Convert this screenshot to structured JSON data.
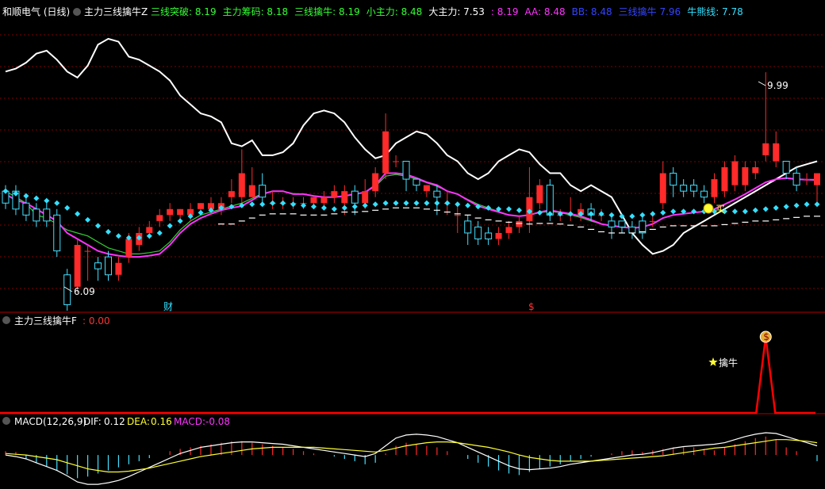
{
  "colors": {
    "up": "#ff2a2a",
    "down": "#44e0ff",
    "white": "#ffffff",
    "magenta": "#ff33ff",
    "green": "#33cc33",
    "cyan": "#33e0ff",
    "yellow": "#ffff33",
    "signal_line": "#ff0000",
    "grid": "#800000",
    "label_green": "#33ff33",
    "label_magenta": "#ff33ff",
    "label_blue": "#3344ff",
    "label_cyan": "#33e0ff",
    "label_red": "#ff3333"
  },
  "main_panel": {
    "stock": "和顺电气 (日线)",
    "indicator": "主力三线擒牛Z",
    "readouts": [
      {
        "label": "三线突破:",
        "value": "8.19",
        "color": "label_green"
      },
      {
        "label": "主力筹码:",
        "value": "8.18",
        "color": "label_green"
      },
      {
        "label": "三线擒牛:",
        "value": "8.19",
        "color": "label_green"
      },
      {
        "label": "小主力:",
        "value": "8.48",
        "color": "label_green"
      },
      {
        "label": "大主力:",
        "value": "7.53",
        "color": "white"
      },
      {
        "label": ":",
        "value": "8.19",
        "color": "label_magenta"
      },
      {
        "label": "AA:",
        "value": "8.48",
        "color": "label_magenta"
      },
      {
        "label": "BB:",
        "value": "8.48",
        "color": "label_blue"
      },
      {
        "label": "三线擒牛",
        "value": "7.96",
        "color": "label_blue"
      },
      {
        "label": "牛熊线:",
        "value": "7.78",
        "color": "label_cyan"
      }
    ],
    "price_high_label": "9.99",
    "price_low_label": "6.09",
    "event_label_cai": "财",
    "event_label_dollar": "$",
    "buy_label": "买"
  },
  "signal_panel": {
    "title": "主力三线擒牛F",
    "value": ": 0.00",
    "signal_label": "擒牛",
    "bag_icon": "$"
  },
  "macd_panel": {
    "title": "MACD(12,26,9)",
    "dif_label": "DIF:",
    "dif_value": "0.12",
    "dea_label": "DEA:",
    "dea_value": "0.16",
    "macd_label": "MACD:",
    "macd_value": "-0.08"
  },
  "chart_data": {
    "type": "candlestick",
    "price_range": [
      6.0,
      10.8
    ],
    "candles": [
      [
        8.0,
        7.8,
        8.1,
        7.7
      ],
      [
        8.0,
        7.7,
        8.1,
        7.6
      ],
      [
        7.8,
        7.6,
        7.9,
        7.5
      ],
      [
        7.7,
        7.5,
        7.8,
        7.4
      ],
      [
        7.7,
        7.5,
        7.8,
        7.4
      ],
      [
        7.6,
        7.0,
        7.7,
        6.9
      ],
      [
        6.6,
        6.1,
        6.7,
        6.0
      ],
      [
        6.4,
        7.1,
        7.2,
        6.3
      ],
      [
        7.0,
        7.0,
        7.1,
        6.5
      ],
      [
        6.8,
        6.7,
        6.9,
        6.5
      ],
      [
        6.9,
        6.6,
        7.0,
        6.5
      ],
      [
        6.6,
        6.8,
        6.9,
        6.5
      ],
      [
        6.9,
        7.2,
        7.3,
        6.8
      ],
      [
        7.1,
        7.3,
        7.4,
        7.0
      ],
      [
        7.3,
        7.4,
        7.5,
        7.2
      ],
      [
        7.5,
        7.6,
        7.7,
        7.4
      ],
      [
        7.6,
        7.7,
        7.8,
        7.5
      ],
      [
        7.6,
        7.7,
        7.7,
        7.5
      ],
      [
        7.6,
        7.7,
        7.8,
        7.5
      ],
      [
        7.7,
        7.8,
        7.8,
        7.6
      ],
      [
        7.7,
        7.8,
        7.9,
        7.6
      ],
      [
        7.7,
        7.8,
        7.9,
        7.6
      ],
      [
        7.9,
        8.0,
        8.2,
        7.8
      ],
      [
        7.9,
        8.3,
        8.7,
        7.8
      ],
      [
        7.9,
        8.1,
        8.4,
        7.9
      ],
      [
        8.1,
        7.9,
        8.3,
        7.8
      ],
      [
        7.8,
        7.8,
        8.0,
        7.7
      ],
      [
        7.8,
        7.8,
        7.9,
        7.7
      ],
      [
        7.8,
        7.8,
        7.9,
        7.7
      ],
      [
        7.8,
        7.8,
        7.9,
        7.7
      ],
      [
        7.8,
        7.9,
        7.9,
        7.7
      ],
      [
        7.8,
        7.9,
        8.0,
        7.7
      ],
      [
        7.9,
        8.0,
        8.1,
        7.8
      ],
      [
        7.8,
        8.0,
        8.1,
        7.6
      ],
      [
        8.0,
        7.8,
        8.1,
        7.6
      ],
      [
        7.8,
        8.0,
        8.2,
        7.7
      ],
      [
        8.0,
        8.3,
        8.4,
        7.9
      ],
      [
        8.3,
        9.0,
        9.3,
        8.2
      ],
      [
        8.5,
        8.5,
        8.6,
        8.4
      ],
      [
        8.5,
        8.2,
        8.5,
        8.0
      ],
      [
        8.2,
        8.1,
        8.2,
        8.0
      ],
      [
        8.0,
        8.1,
        8.1,
        7.9
      ],
      [
        8.0,
        7.9,
        8.1,
        7.6
      ],
      [
        7.8,
        7.8,
        8.0,
        7.6
      ],
      [
        7.6,
        7.6,
        7.8,
        7.3
      ],
      [
        7.5,
        7.3,
        7.6,
        7.1
      ],
      [
        7.4,
        7.2,
        7.5,
        7.1
      ],
      [
        7.3,
        7.2,
        7.4,
        7.1
      ],
      [
        7.2,
        7.3,
        7.4,
        7.1
      ],
      [
        7.3,
        7.4,
        7.5,
        7.2
      ],
      [
        7.4,
        7.5,
        7.6,
        7.3
      ],
      [
        7.5,
        7.9,
        8.4,
        7.3
      ],
      [
        7.8,
        8.1,
        8.2,
        7.7
      ],
      [
        8.1,
        7.6,
        8.2,
        7.5
      ],
      [
        7.6,
        7.6,
        7.7,
        7.5
      ],
      [
        7.6,
        7.6,
        7.9,
        7.5
      ],
      [
        7.6,
        7.7,
        7.8,
        7.5
      ],
      [
        7.7,
        7.6,
        7.8,
        7.5
      ],
      [
        7.6,
        7.6,
        7.7,
        7.5
      ],
      [
        7.5,
        7.4,
        7.6,
        7.2
      ],
      [
        7.5,
        7.4,
        7.5,
        7.3
      ],
      [
        7.4,
        7.3,
        7.5,
        7.2
      ],
      [
        7.5,
        7.3,
        7.6,
        7.2
      ],
      [
        7.5,
        7.5,
        7.6,
        7.4
      ],
      [
        7.8,
        8.3,
        8.5,
        7.7
      ],
      [
        8.3,
        8.1,
        8.4,
        7.9
      ],
      [
        8.1,
        8.0,
        8.2,
        7.9
      ],
      [
        8.1,
        8.0,
        8.2,
        7.9
      ],
      [
        8.0,
        7.9,
        8.1,
        7.8
      ],
      [
        7.9,
        8.2,
        8.3,
        7.8
      ],
      [
        8.0,
        8.4,
        8.5,
        7.9
      ],
      [
        8.1,
        8.5,
        8.6,
        8.0
      ],
      [
        8.1,
        8.4,
        8.5,
        8.0
      ],
      [
        8.3,
        8.4,
        8.5,
        8.2
      ],
      [
        8.6,
        8.8,
        9.99,
        8.5
      ],
      [
        8.5,
        8.8,
        9.0,
        8.4
      ],
      [
        8.5,
        8.3,
        8.5,
        8.2
      ],
      [
        8.3,
        8.1,
        8.4,
        8.0
      ],
      [
        8.2,
        8.2,
        8.3,
        8.1
      ],
      [
        8.1,
        8.3,
        8.3,
        7.8
      ]
    ],
    "bull_bear_line": [
      7.9,
      7.88,
      7.85,
      7.8,
      7.75,
      7.7,
      7.6,
      7.45,
      7.35,
      7.25,
      7.15,
      7.1,
      7.1,
      7.15,
      7.2,
      7.3,
      7.4,
      7.45,
      7.5,
      7.55,
      7.6,
      7.65,
      7.65,
      7.7,
      7.75,
      7.8,
      7.82,
      7.82,
      7.82,
      7.8,
      7.8,
      7.8,
      7.82,
      7.85,
      7.85,
      7.86,
      7.88,
      7.9,
      7.92,
      7.92,
      7.92,
      7.9,
      7.88,
      7.85,
      7.82,
      7.8,
      7.75,
      7.72,
      7.7,
      7.68,
      7.66,
      7.65,
      7.66,
      7.66,
      7.65,
      7.63,
      7.6,
      7.56,
      7.52,
      7.5,
      7.5,
      7.5,
      7.52,
      7.56,
      7.6,
      7.62,
      7.62,
      7.62,
      7.62,
      7.62,
      7.64,
      7.66,
      7.68,
      7.7,
      7.7,
      7.72,
      7.74,
      7.76,
      7.78,
      7.78
    ],
    "main_force_line": [
      7.95,
      7.85,
      7.8,
      7.7,
      7.6,
      7.5,
      7.3,
      7.2,
      7.1,
      7.0,
      6.95,
      6.92,
      6.9,
      6.9,
      6.92,
      6.95,
      7.1,
      7.3,
      7.45,
      7.55,
      7.62,
      7.68,
      7.72,
      7.75,
      7.85,
      7.95,
      8.0,
      8.0,
      7.95,
      7.95,
      7.92,
      7.9,
      7.9,
      7.92,
      7.95,
      7.98,
      8.1,
      8.3,
      8.3,
      8.28,
      8.22,
      8.15,
      8.1,
      8.0,
      7.95,
      7.85,
      7.75,
      7.7,
      7.65,
      7.6,
      7.58,
      7.6,
      7.65,
      7.68,
      7.65,
      7.62,
      7.58,
      7.52,
      7.45,
      7.42,
      7.4,
      7.38,
      7.4,
      7.45,
      7.55,
      7.6,
      7.62,
      7.64,
      7.66,
      7.7,
      7.78,
      7.86,
      7.95,
      8.05,
      8.15,
      8.2,
      8.22,
      8.2,
      8.19,
      8.19
    ],
    "green_line": [
      8.0,
      7.9,
      7.8,
      7.6,
      7.55,
      7.45,
      7.35,
      7.3,
      7.25,
      7.15,
      7.05,
      7.0,
      6.95,
      6.95,
      6.97,
      7.0,
      7.15,
      7.35,
      7.5,
      7.6,
      7.65,
      7.7,
      7.75,
      7.8,
      7.88,
      7.96,
      8.0,
      8.0,
      7.96,
      7.95,
      7.92,
      7.9,
      7.9,
      7.92,
      7.95,
      7.98,
      8.08,
      8.25,
      8.28,
      8.25,
      8.2,
      8.14,
      8.08,
      8.0,
      7.95,
      7.86,
      7.78,
      7.72,
      7.66,
      7.6,
      7.58,
      7.6,
      7.64,
      7.66,
      7.64,
      7.6,
      7.56,
      7.5,
      7.45,
      7.42,
      7.4,
      7.38,
      7.4,
      7.45,
      7.55,
      7.6,
      7.62,
      7.64,
      7.66,
      7.7,
      7.78,
      7.86,
      7.95,
      8.05,
      8.15,
      8.2,
      8.22,
      8.2,
      8.19,
      8.18
    ],
    "dots_line": [
      8.0,
      7.96,
      7.92,
      7.88,
      7.84,
      7.8,
      7.72,
      7.62,
      7.52,
      7.42,
      7.32,
      7.25,
      7.22,
      7.22,
      7.25,
      7.3,
      7.42,
      7.5,
      7.58,
      7.64,
      7.68,
      7.72,
      7.74,
      7.76,
      7.78,
      7.78,
      7.8,
      7.8,
      7.78,
      7.76,
      7.74,
      7.72,
      7.7,
      7.72,
      7.74,
      7.76,
      7.78,
      7.8,
      7.8,
      7.8,
      7.8,
      7.8,
      7.8,
      7.8,
      7.78,
      7.76,
      7.74,
      7.72,
      7.7,
      7.7,
      7.68,
      7.66,
      7.64,
      7.62,
      7.62,
      7.62,
      7.62,
      7.62,
      7.62,
      7.6,
      7.58,
      7.58,
      7.6,
      7.62,
      7.64,
      7.66,
      7.66,
      7.66,
      7.66,
      7.66,
      7.66,
      7.66,
      7.66,
      7.68,
      7.7,
      7.72,
      7.74,
      7.76,
      7.78,
      7.78
    ],
    "white_envelope": [
      10.0,
      10.05,
      10.15,
      10.3,
      10.35,
      10.2,
      10.0,
      9.9,
      10.1,
      10.45,
      10.55,
      10.5,
      10.25,
      10.2,
      10.1,
      10.0,
      9.85,
      9.6,
      9.45,
      9.3,
      9.25,
      9.15,
      8.8,
      8.75,
      8.85,
      8.6,
      8.6,
      8.65,
      8.8,
      9.1,
      9.3,
      9.35,
      9.3,
      9.15,
      8.9,
      8.7,
      8.55,
      8.6,
      8.8,
      8.9,
      9.0,
      8.95,
      8.8,
      8.6,
      8.5,
      8.3,
      8.2,
      8.3,
      8.5,
      8.6,
      8.7,
      8.65,
      8.45,
      8.3,
      8.3,
      8.1,
      8.0,
      8.1,
      8.0,
      7.9,
      7.6,
      7.3,
      7.1,
      6.95,
      7.0,
      7.1,
      7.3,
      7.4,
      7.5,
      7.6,
      7.7,
      7.8,
      7.9,
      8.0,
      8.1,
      8.2,
      8.3,
      8.4,
      8.45,
      8.5
    ],
    "macd_bars": [
      0.05,
      0.04,
      -0.05,
      -0.1,
      -0.15,
      -0.2,
      -0.25,
      -0.3,
      -0.28,
      -0.24,
      -0.2,
      -0.16,
      -0.12,
      -0.08,
      -0.04,
      0.0,
      0.05,
      0.08,
      0.1,
      0.12,
      0.14,
      0.16,
      0.18,
      0.18,
      0.16,
      0.14,
      0.12,
      0.1,
      0.08,
      0.05,
      0.02,
      0.0,
      -0.02,
      -0.05,
      -0.08,
      -0.12,
      -0.1,
      0.02,
      0.12,
      0.16,
      0.14,
      0.12,
      0.1,
      0.05,
      0.0,
      -0.05,
      -0.1,
      -0.15,
      -0.2,
      -0.24,
      -0.26,
      -0.22,
      -0.18,
      -0.15,
      -0.12,
      -0.08,
      -0.05,
      -0.02,
      0.0,
      0.02,
      0.05,
      0.06,
      0.04,
      0.06,
      0.08,
      0.1,
      0.1,
      0.1,
      0.08,
      0.06,
      0.1,
      0.14,
      0.18,
      0.22,
      0.24,
      0.2,
      0.1,
      0.05,
      0.0,
      -0.08
    ],
    "dif": [
      0.0,
      -0.02,
      -0.05,
      -0.1,
      -0.15,
      -0.2,
      -0.27,
      -0.35,
      -0.38,
      -0.38,
      -0.36,
      -0.33,
      -0.28,
      -0.22,
      -0.16,
      -0.1,
      -0.04,
      0.02,
      0.06,
      0.1,
      0.12,
      0.14,
      0.16,
      0.17,
      0.17,
      0.16,
      0.15,
      0.14,
      0.12,
      0.1,
      0.08,
      0.06,
      0.04,
      0.02,
      0.0,
      -0.02,
      0.02,
      0.12,
      0.22,
      0.26,
      0.27,
      0.26,
      0.24,
      0.2,
      0.16,
      0.1,
      0.04,
      -0.02,
      -0.08,
      -0.14,
      -0.18,
      -0.19,
      -0.18,
      -0.17,
      -0.15,
      -0.12,
      -0.1,
      -0.08,
      -0.06,
      -0.04,
      -0.02,
      0.0,
      0.01,
      0.03,
      0.06,
      0.09,
      0.11,
      0.12,
      0.13,
      0.14,
      0.16,
      0.2,
      0.24,
      0.27,
      0.29,
      0.28,
      0.24,
      0.2,
      0.16,
      0.12
    ],
    "dea": [
      0.02,
      0.01,
      0.0,
      -0.02,
      -0.04,
      -0.06,
      -0.1,
      -0.14,
      -0.18,
      -0.2,
      -0.22,
      -0.22,
      -0.21,
      -0.19,
      -0.17,
      -0.14,
      -0.11,
      -0.08,
      -0.05,
      -0.02,
      0.0,
      0.02,
      0.04,
      0.06,
      0.08,
      0.09,
      0.1,
      0.1,
      0.1,
      0.1,
      0.1,
      0.09,
      0.08,
      0.07,
      0.06,
      0.05,
      0.04,
      0.06,
      0.09,
      0.12,
      0.14,
      0.16,
      0.17,
      0.17,
      0.16,
      0.14,
      0.12,
      0.1,
      0.07,
      0.04,
      0.0,
      -0.03,
      -0.05,
      -0.07,
      -0.08,
      -0.08,
      -0.08,
      -0.08,
      -0.07,
      -0.06,
      -0.05,
      -0.04,
      -0.03,
      -0.02,
      -0.01,
      0.01,
      0.03,
      0.05,
      0.07,
      0.09,
      0.1,
      0.12,
      0.14,
      0.16,
      0.18,
      0.2,
      0.2,
      0.19,
      0.18,
      0.16
    ],
    "signal": {
      "index": 74,
      "peak": 1.0
    }
  }
}
